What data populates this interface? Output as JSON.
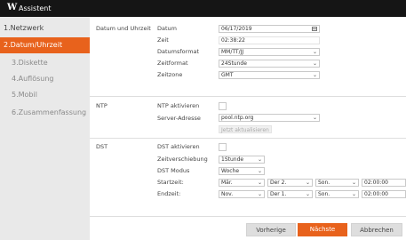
{
  "window": {
    "logo": "W",
    "title": "Assistent"
  },
  "sidebar": {
    "items": [
      {
        "label": "1.Netzwerk"
      },
      {
        "label": "2.Datum/Uhrzeit"
      },
      {
        "label": "3.Diskette"
      },
      {
        "label": "4.Auflösung"
      },
      {
        "label": "5.Mobil"
      },
      {
        "label": "6.Zusammenfassung"
      }
    ],
    "active_index": 1
  },
  "datetime": {
    "section_label": "Datum und Uhrzeit",
    "date_label": "Datum",
    "date_value": "06/17/2019",
    "time_label": "Zeit",
    "time_value": "02:38:22",
    "dateformat_label": "Datumsformat",
    "dateformat_value": "MM/TT/JJ",
    "timeformat_label": "Zeitformat",
    "timeformat_value": "24Stunde",
    "timezone_label": "Zeitzone",
    "timezone_value": "GMT"
  },
  "ntp": {
    "section_label": "NTP",
    "enable_label": "NTP aktivieren",
    "enabled": false,
    "server_label": "Server-Adresse",
    "server_value": "pool.ntp.org",
    "update_button": "Jetzt aktualisieren"
  },
  "dst": {
    "section_label": "DST",
    "enable_label": "DST aktivieren",
    "enabled": false,
    "offset_label": "Zeitverschiebung",
    "offset_value": "1Stunde",
    "mode_label": "DST Modus",
    "mode_value": "Woche",
    "start_label": "Startzeit:",
    "start_month": "Mär.",
    "start_week": "Der 2.",
    "start_day": "Son.",
    "start_time": "02:00:00",
    "end_label": "Endzeit:",
    "end_month": "Nov.",
    "end_week": "Der 1.",
    "end_day": "Son.",
    "end_time": "02:00:00"
  },
  "footer": {
    "prev_label": "Vorherige",
    "next_label": "Nächste",
    "cancel_label": "Abbrechen"
  },
  "colors": {
    "accent": "#e8621c",
    "titlebar": "#151515",
    "sidebar_bg": "#e9e9e9"
  },
  "icons": {
    "calendar": "calendar-icon",
    "dropdown": "chevron-down-icon"
  }
}
